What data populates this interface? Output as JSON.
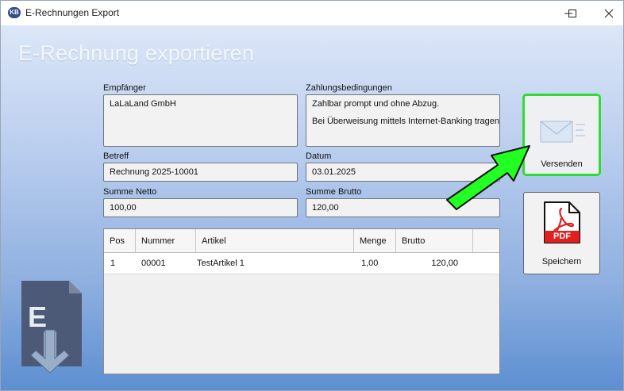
{
  "window": {
    "icon_text": "KB",
    "title": "E-Rechnungen Export"
  },
  "page": {
    "title": "E-Rechnung exportieren"
  },
  "form": {
    "recipient_label": "Empfänger",
    "recipient_value": "LaLaLand GmbH",
    "payment_terms_label": "Zahlungsbedingungen",
    "payment_terms_line1": "Zahlbar prompt und ohne Abzug.",
    "payment_terms_line2": "Bei Überweisung mittels Internet-Banking tragen S",
    "subject_label": "Betreff",
    "subject_value": "Rechnung 2025-10001",
    "date_label": "Datum",
    "date_value": "03.01.2025",
    "net_label": "Summe Netto",
    "net_value": "100,00",
    "gross_label": "Summe Brutto",
    "gross_value": "120,00"
  },
  "table": {
    "headers": [
      "Pos",
      "Nummer",
      "Artikel",
      "Menge",
      "Brutto"
    ],
    "rows": [
      {
        "pos": "1",
        "nummer": "00001",
        "artikel": "TestArtikel 1",
        "menge": "1,00",
        "brutto": "120,00"
      }
    ]
  },
  "buttons": {
    "send_label": "Versenden",
    "save_label": "Speichern",
    "pdf_badge": "PDF"
  },
  "logo": {
    "letter": "E"
  },
  "colors": {
    "highlight": "#2ede2e",
    "arrow": "#22ff22",
    "pdf_red": "#e02020"
  }
}
